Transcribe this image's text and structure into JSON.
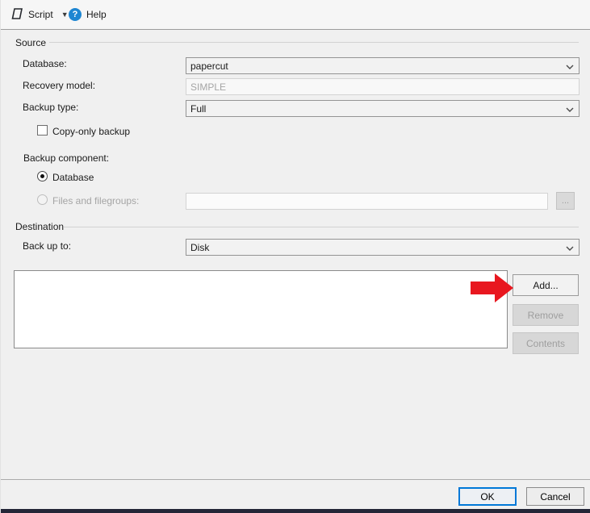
{
  "toolbar": {
    "script_label": "Script",
    "help_label": "Help",
    "help_icon_glyph": "?"
  },
  "source": {
    "group_label": "Source",
    "database_label": "Database:",
    "database_value": "papercut",
    "recovery_label": "Recovery model:",
    "recovery_value": "SIMPLE",
    "backup_type_label": "Backup type:",
    "backup_type_value": "Full",
    "copy_only_label": "Copy-only backup",
    "component_label": "Backup component:",
    "radio_database_label": "Database",
    "radio_files_label": "Files and filegroups:",
    "files_value": "",
    "browse_button_label": "..."
  },
  "destination": {
    "group_label": "Destination",
    "backup_to_label": "Back up to:",
    "backup_to_value": "Disk",
    "list_items": [],
    "add_label": "Add...",
    "remove_label": "Remove",
    "contents_label": "Contents"
  },
  "footer": {
    "ok_label": "OK",
    "cancel_label": "Cancel"
  },
  "colors": {
    "accent_blue": "#0078d7",
    "arrow_red": "#e8171f",
    "help_icon_blue": "#1e86d2",
    "window_bg": "#f0f0f0",
    "bottom_strip": "#232637"
  }
}
